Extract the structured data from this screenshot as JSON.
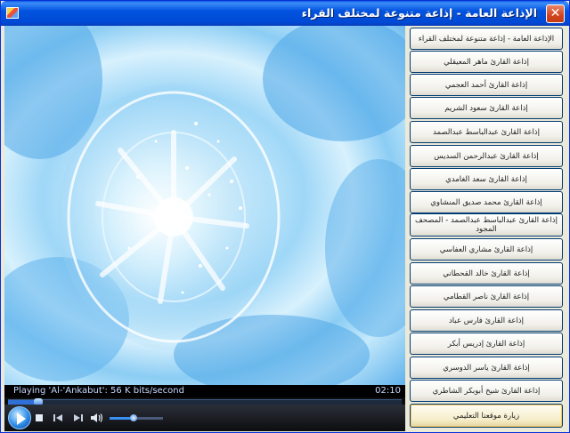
{
  "window": {
    "title": "الإذاعة العامة - إذاعة متنوعة لمختلف القراء",
    "close_glyph": "✕"
  },
  "player": {
    "status": "Playing 'Al-'Ankabut': 56 K bits/second",
    "time": "02:10",
    "seek_fraction": 0.07,
    "volume_fraction": 0.45,
    "icons": [
      "play-icon",
      "stop-icon",
      "previous-icon",
      "next-icon",
      "volume-icon"
    ]
  },
  "menu": {
    "items": [
      "الإذاعة العامة - إذاعة متنوعة لمختلف القراء",
      "إذاعة القارئ ماهر المعيقلي",
      "إذاعة القارئ أحمد العجمي",
      "إذاعة القارئ سعود الشريم",
      "إذاعة القارئ عبدالباسط عبدالصمد",
      "إذاعة القارئ عبدالرحمن السديس",
      "إذاعة القارئ سعد الغامدي",
      "إذاعة القارئ محمد صديق المنشاوي",
      "إذاعة القارئ عبدالباسط عبدالصمد - المصحف المجود",
      "إذاعة القارئ مشاري العفاسي",
      "إذاعة القارئ خالد القحطاني",
      "إذاعة القارئ ناصر القطامي",
      "إذاعة القارئ فارس عباد",
      "إذاعة القارئ إدريس أبكر",
      "إذاعة القارئ ياسر الدوسري",
      "إذاعة القارئ شيخ أبوبكر الشاطري",
      "زيارة موقعنا التعليمي"
    ]
  }
}
